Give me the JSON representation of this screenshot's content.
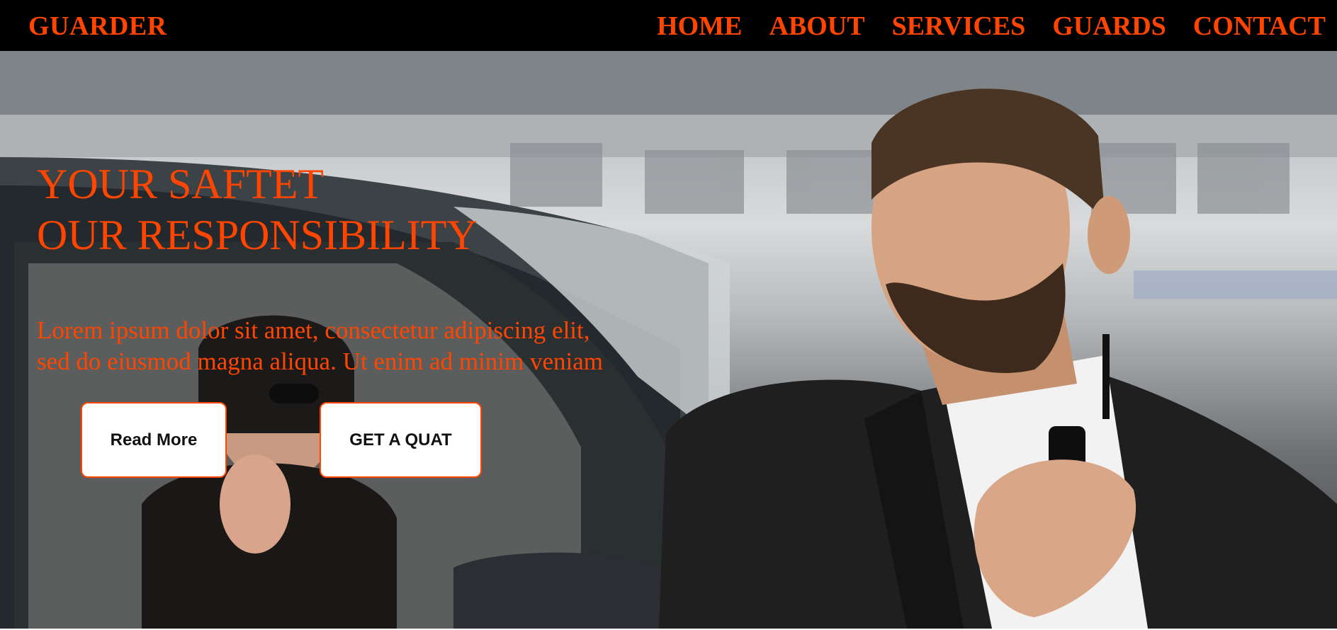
{
  "navbar": {
    "brand": "GUARDER",
    "links": [
      "HOME",
      "ABOUT",
      "SERVICES",
      "GUARDS",
      "CONTACT"
    ]
  },
  "hero": {
    "title_lines": [
      "YOUR SAFTET",
      "OUR RESPONSIBILITY"
    ],
    "text_lines": [
      "Lorem ipsum dolor sit amet, consectetur adipiscing elit,",
      "sed do eiusmod magna aliqua. Ut enim ad minim veniam"
    ],
    "read_more_label": "Read More",
    "quote_label": "GET A QUAT"
  },
  "colors": {
    "accent": "#ff4500",
    "navbar_bg": "#000000",
    "button_bg": "#ffffff"
  }
}
